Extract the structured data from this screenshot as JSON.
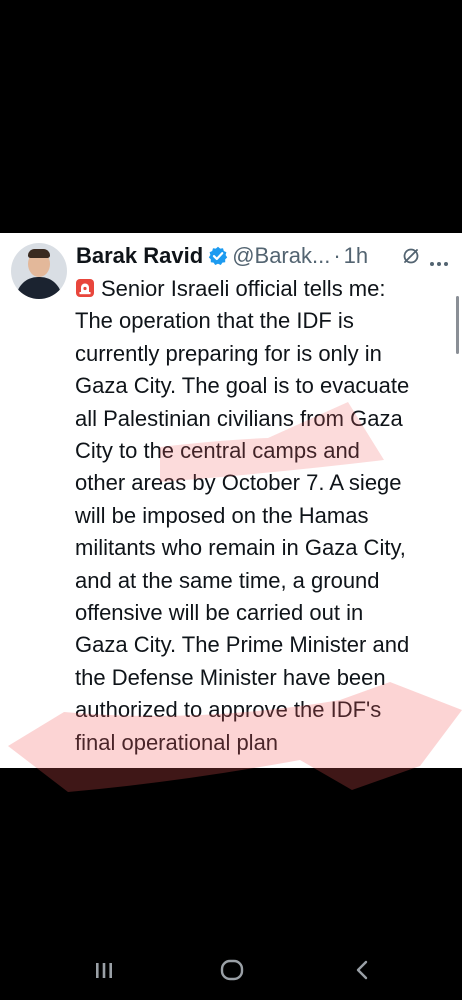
{
  "tweet": {
    "author_name": "Barak Ravid",
    "handle": "@Barak...",
    "separator": "·",
    "time": "1h",
    "lines": [
      "Senior Israeli official tells me:",
      "The operation that the IDF is",
      "currently preparing for is only in",
      "Gaza City. The goal is to evacuate",
      "all Palestinian civilians from Gaza",
      "City to the central camps and",
      "other areas by October 7. A siege",
      "will be imposed on the Hamas",
      "militants who remain in Gaza City,",
      "and at the same time, a ground",
      "offensive will be carried out in",
      "Gaza City. The Prime Minister and",
      "the Defense Minister have been",
      "authorized to approve the IDF's",
      "final operational plan"
    ]
  },
  "icons": {
    "verified": "verified-badge-icon",
    "siren": "siren-emoji-icon",
    "grok": "grok-icon",
    "more": "more-options-icon",
    "nav_recents": "recents-icon",
    "nav_home": "home-icon",
    "nav_back": "back-icon"
  },
  "colors": {
    "verified": "#1d9bf0",
    "text": "#0f1419",
    "secondary": "#536471",
    "highlight": "#f25a5a"
  }
}
